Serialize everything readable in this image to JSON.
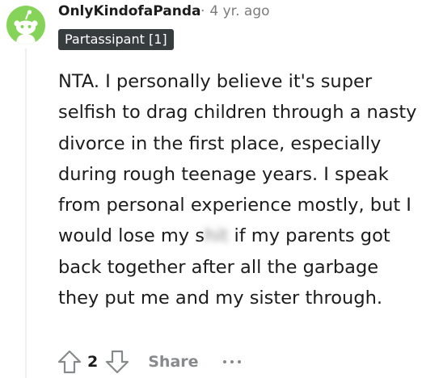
{
  "comment": {
    "username": "OnlyKindofaPanda",
    "separator": "·",
    "age": "4 yr. ago",
    "flair": "Partassipant [1]",
    "body_before": "NTA. I personally believe it's super selfish to drag children through a nasty divorce in the first place, especially during rough teenage years. I speak from personal experience mostly, but I would lose my s",
    "body_censored": "hit",
    "body_after": " if my parents got back together after all the garbage they put me and my sister through.",
    "vote_count": "2",
    "share_label": "Share"
  },
  "icons": {
    "avatar": "reddit-snoo-avatar",
    "upvote": "upvote-arrow-icon",
    "downvote": "downvote-arrow-icon",
    "more": "more-options-icon"
  },
  "colors": {
    "avatar_bg": "#86d35a",
    "flair_bg": "#373c3f",
    "muted": "#878a8c"
  }
}
